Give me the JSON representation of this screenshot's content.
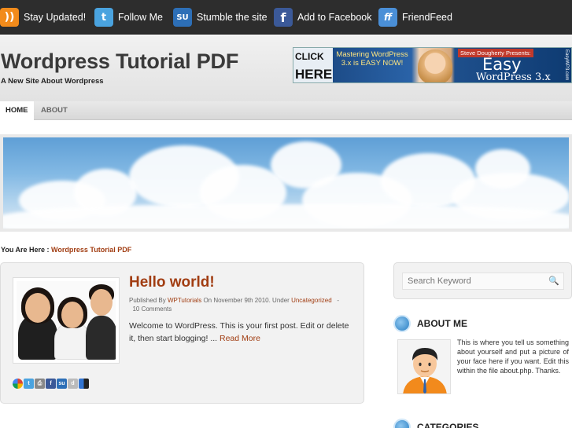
{
  "topbar": {
    "items": [
      {
        "icon": "rss-icon",
        "label": "Stay Updated!"
      },
      {
        "icon": "twitter-icon",
        "label": "Follow Me"
      },
      {
        "icon": "stumbleupon-icon",
        "label": "Stumble the site"
      },
      {
        "icon": "facebook-icon",
        "label": "Add to Facebook"
      },
      {
        "icon": "friendfeed-icon",
        "label": "FriendFeed"
      }
    ]
  },
  "header": {
    "title": "Wordpress Tutorial PDF",
    "tagline": "A New Site About Wordpress",
    "ad": {
      "click": "CLICK",
      "here": "HERE",
      "mastering": "Mastering WordPress 3.x is EASY NOW!",
      "presenter": "Steve Dougherty Presents:",
      "easy": "Easy",
      "wordpress": "WordPress 3.x",
      "url": "EasyWP3.com"
    }
  },
  "nav": {
    "items": [
      {
        "label": "HOME",
        "active": true
      },
      {
        "label": "ABOUT",
        "active": false
      }
    ]
  },
  "breadcrumb": {
    "prefix": "You Are Here :",
    "current": "Wordpress Tutorial PDF"
  },
  "post": {
    "title": "Hello world!",
    "meta_prefix": "Published By",
    "author": "WPTutorials",
    "date_text": "On November 9th 2010. Under",
    "category": "Uncategorized",
    "separator": "-",
    "comments": "10 Comments",
    "excerpt": "Welcome to WordPress. This is your first post. Edit or delete it, then start blogging! ...",
    "read_more": "Read More",
    "share_icons": [
      "google-icon",
      "twitter-icon",
      "print-icon",
      "facebook-icon",
      "stumbleupon-icon",
      "digg-icon",
      "delicious-icon"
    ]
  },
  "sidebar": {
    "search_placeholder": "Search Keyword",
    "about_title": "ABOUT ME",
    "about_text": "This is where you tell us something about yourself and put a picture of your face here if you want. Edit this within the file about.php. Thanks.",
    "categories_title": "CATEGORIES"
  },
  "colors": {
    "topbar": "#2d2d2d",
    "accent_link": "#a13d12",
    "title": "#3a3a3a"
  }
}
